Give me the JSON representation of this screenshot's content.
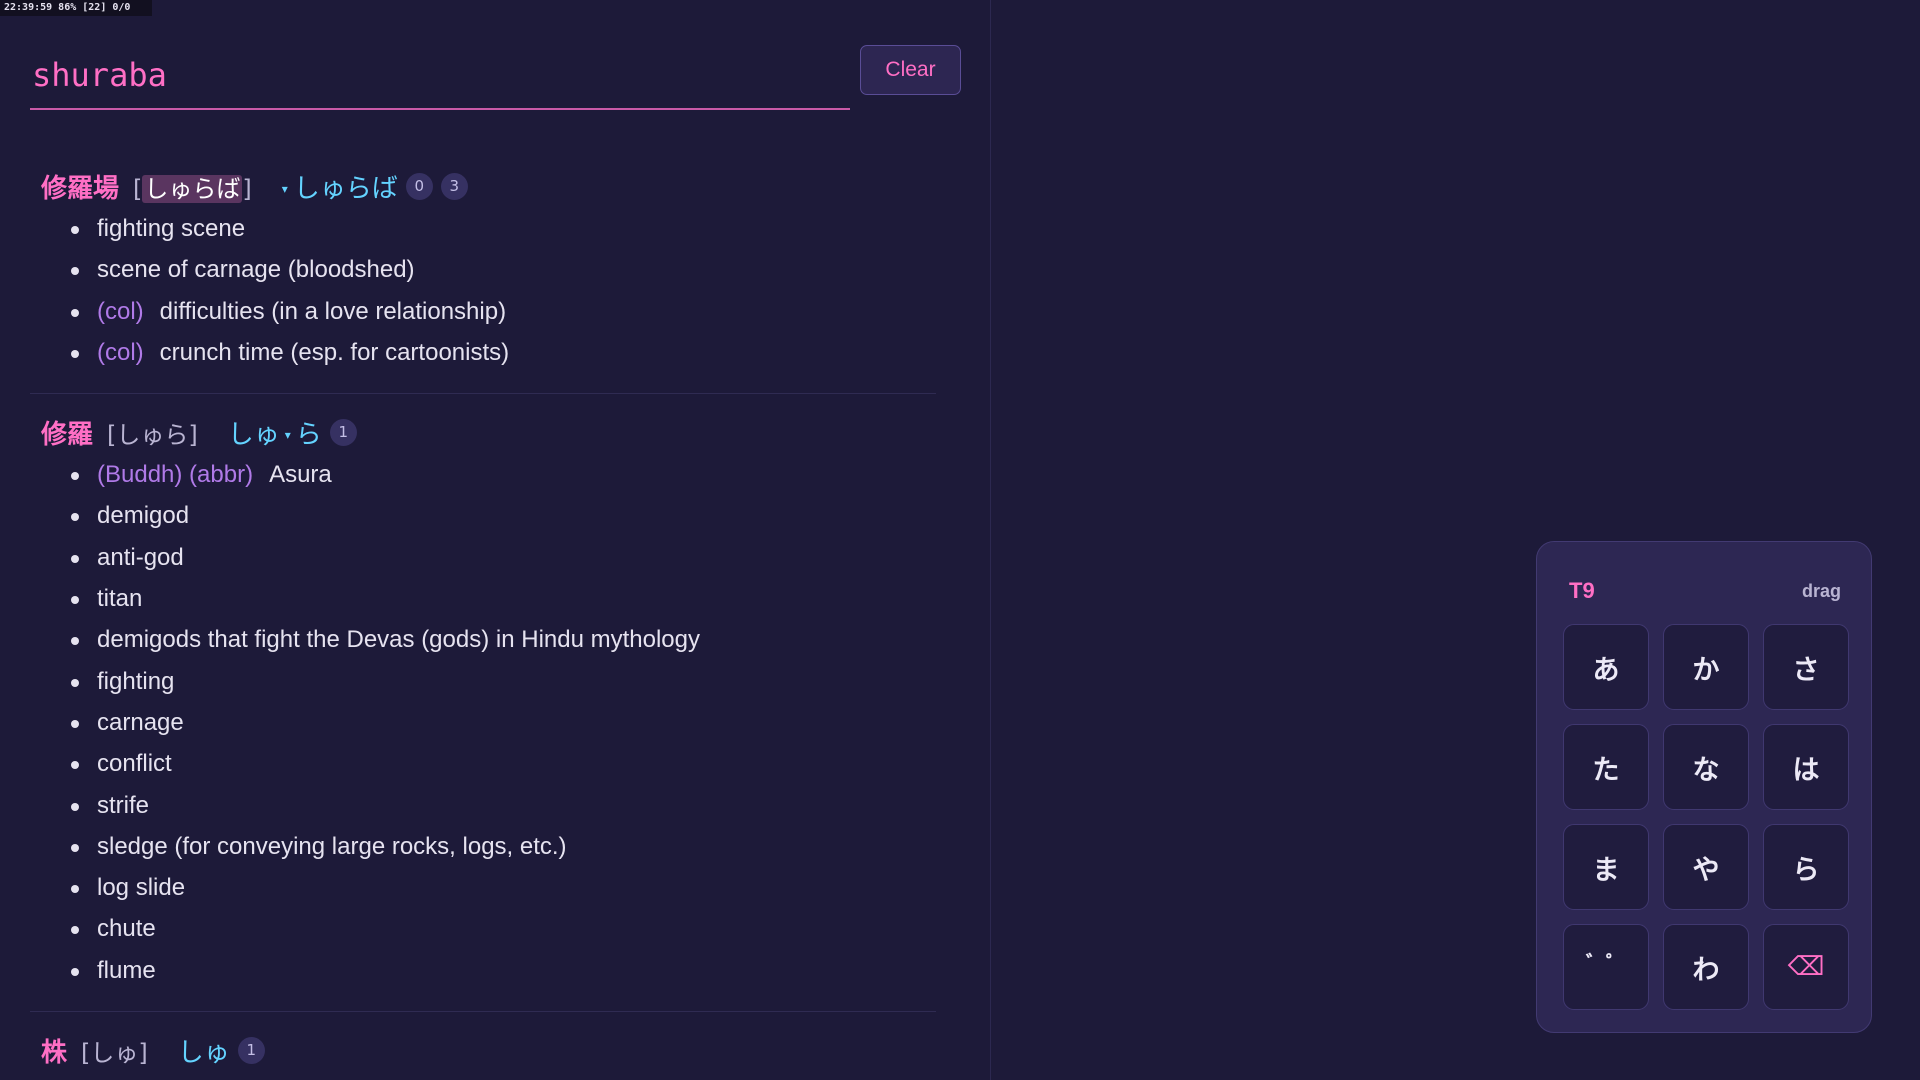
{
  "status_bar": {
    "text": "22:39:59 86% [22] 0/0"
  },
  "search": {
    "value": "shuraba",
    "clear_label": "Clear"
  },
  "entries": [
    {
      "kanji": "修羅場",
      "reading_open": "[",
      "reading": "しゅらば",
      "reading_close": "]",
      "kana_caret": "▾",
      "kana": "しゅらば",
      "badges": [
        "0",
        "3"
      ],
      "senses": [
        {
          "tags": "",
          "text": "fighting scene"
        },
        {
          "tags": "",
          "text": "scene of carnage (bloodshed)"
        },
        {
          "tags": "(col)",
          "text": "difficulties (in a love relationship)"
        },
        {
          "tags": "(col)",
          "text": "crunch time (esp. for cartoonists)"
        }
      ]
    },
    {
      "kanji": "修羅",
      "reading": "[しゅら]",
      "kana_part1": "しゅ",
      "kana_caret": "▾",
      "kana_part2": "ら",
      "badges": [
        "1"
      ],
      "senses": [
        {
          "tags": "(Buddh) (abbr)",
          "text": "Asura"
        },
        {
          "tags": "",
          "text": "demigod"
        },
        {
          "tags": "",
          "text": "anti-god"
        },
        {
          "tags": "",
          "text": "titan"
        },
        {
          "tags": "",
          "text": "demigods that fight the Devas (gods) in Hindu mythology"
        },
        {
          "tags": "",
          "text": "fighting"
        },
        {
          "tags": "",
          "text": "carnage"
        },
        {
          "tags": "",
          "text": "conflict"
        },
        {
          "tags": "",
          "text": "strife"
        },
        {
          "tags": "",
          "text": "sledge (for conveying large rocks, logs, etc.)"
        },
        {
          "tags": "",
          "text": "log slide"
        },
        {
          "tags": "",
          "text": "chute"
        },
        {
          "tags": "",
          "text": "flume"
        }
      ]
    },
    {
      "kanji": "株",
      "reading": "[しゅ]",
      "kana": "しゅ",
      "badges": [
        "1"
      ],
      "senses": []
    }
  ],
  "t9": {
    "title": "T9",
    "drag_label": "drag",
    "keys": [
      "あ",
      "か",
      "さ",
      "た",
      "な",
      "は",
      "ま",
      "や",
      "ら",
      "゛゜",
      "わ",
      "⌫"
    ]
  },
  "colors": {
    "background": "#1d1a39",
    "accent_pink": "#ff6fc5",
    "kana_cyan": "#64d3ff",
    "tag_purple": "#b07ae8",
    "panel": "#2d2753"
  }
}
